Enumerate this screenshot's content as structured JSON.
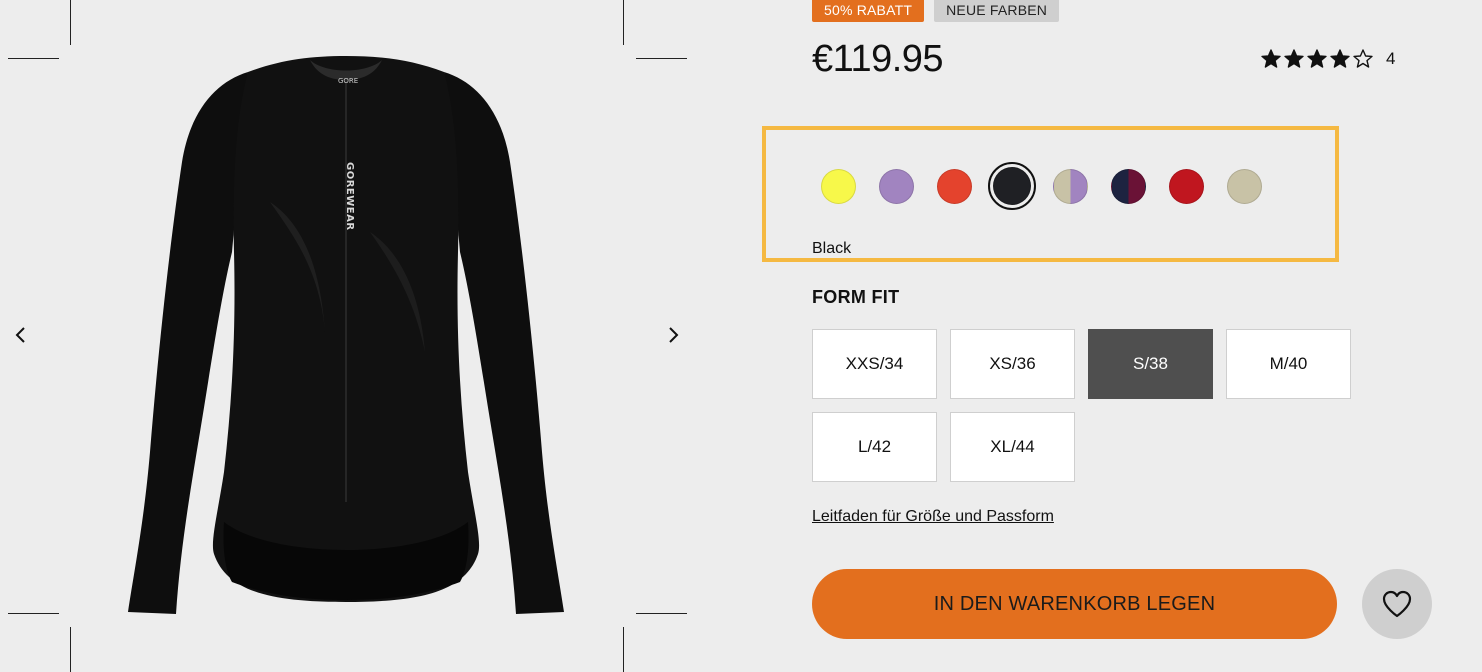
{
  "badges": {
    "sale": "50% RABATT",
    "new": "NEUE FARBEN"
  },
  "product": {
    "price": "€119.95",
    "rating_value": 4,
    "rating_max": 5,
    "rating_count": "4",
    "jersey_print": {
      "neck_label": "GORE",
      "chest_logo": "GOREWEAR"
    }
  },
  "colors": {
    "selected_name": "Black",
    "swatches": [
      {
        "name": "yellow",
        "fill": "#f7f84a"
      },
      {
        "name": "lavender",
        "fill": "#a184c0"
      },
      {
        "name": "red-orange",
        "fill": "#e4432d"
      },
      {
        "name": "black",
        "fill": "#1f2024",
        "selected": true
      },
      {
        "name": "beige-lavender",
        "fill": "#c8c2a6",
        "fill2": "#a184c0"
      },
      {
        "name": "navy-burgundy",
        "fill": "#1d2340",
        "fill2": "#6a1236"
      },
      {
        "name": "red",
        "fill": "#c0161f"
      },
      {
        "name": "beige",
        "fill": "#c8c2a6"
      }
    ]
  },
  "fit": {
    "title": "FORM FIT",
    "sizes": [
      {
        "label": "XXS/34"
      },
      {
        "label": "XS/36"
      },
      {
        "label": "S/38",
        "selected": true
      },
      {
        "label": "M/40"
      },
      {
        "label": "L/42"
      },
      {
        "label": "XL/44"
      }
    ],
    "guide_link": "Leitfaden für Größe und Passform"
  },
  "actions": {
    "add_to_cart": "IN DEN WARENKORB LEGEN"
  },
  "colors_theme": {
    "accent": "#e36f1e",
    "highlight_border": "#f5b942",
    "selected_size_bg": "#4f4f4f"
  },
  "icons": {
    "prev": "chevron-left-icon",
    "next": "chevron-right-icon",
    "wishlist": "heart-icon",
    "star": "star-icon"
  }
}
